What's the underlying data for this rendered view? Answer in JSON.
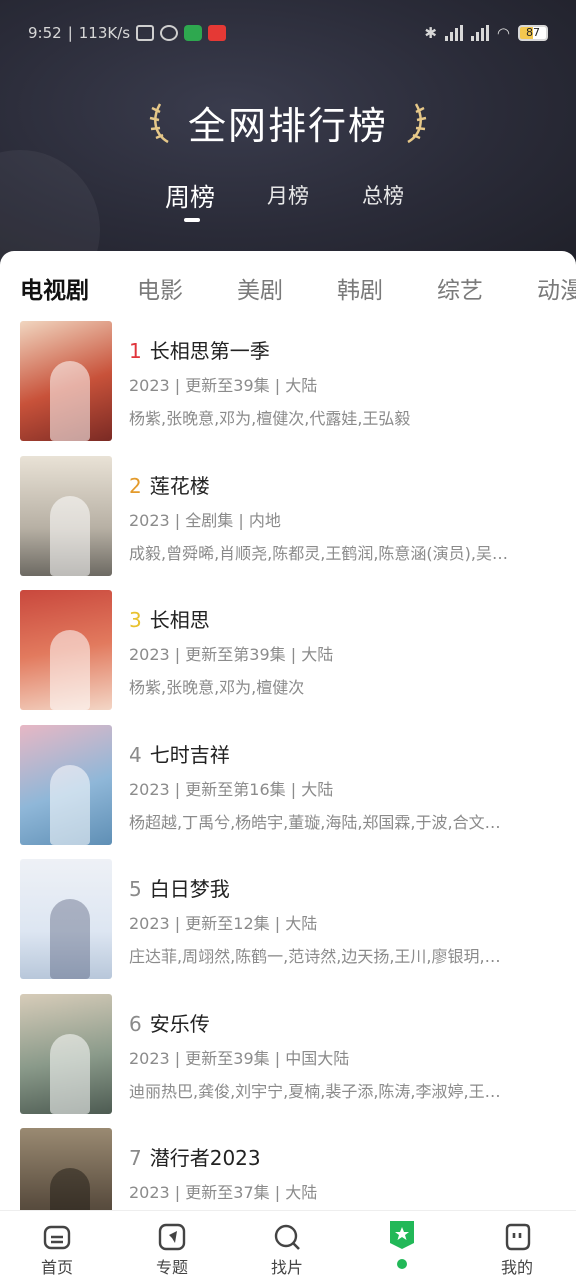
{
  "status_bar": {
    "time": "9:52",
    "speed": "113K/s",
    "battery": "87"
  },
  "header": {
    "title": "全网排行榜",
    "period_tabs": [
      "周榜",
      "月榜",
      "总榜"
    ],
    "active_period": "周榜"
  },
  "category_tabs": [
    "电视剧",
    "电影",
    "美剧",
    "韩剧",
    "综艺",
    "动漫"
  ],
  "active_category": "电视剧",
  "colors": {
    "rank_1": "#e0343b",
    "rank_2": "#e39a2b",
    "rank_3": "#e8c12e",
    "rank_other": "#8a8a8a",
    "accent_green": "#22b858"
  },
  "items": [
    {
      "rank": "1",
      "title": "长相思第一季",
      "meta": "2023 | 更新至39集 | 大陆",
      "cast": "杨紫,张晚意,邓为,檀健次,代露娃,王弘毅"
    },
    {
      "rank": "2",
      "title": "莲花楼",
      "meta": "2023 | 全剧集 | 内地",
      "cast": "成毅,曾舜晞,肖顺尧,陈都灵,王鹤润,陈意涵(演员),吴…"
    },
    {
      "rank": "3",
      "title": "长相思",
      "meta": "2023 | 更新至第39集 | 大陆",
      "cast": "杨紫,张晚意,邓为,檀健次"
    },
    {
      "rank": "4",
      "title": "七时吉祥",
      "meta": "2023 | 更新至第16集 | 大陆",
      "cast": "杨超越,丁禹兮,杨皓宇,董璇,海陆,郑国霖,于波,合文…"
    },
    {
      "rank": "5",
      "title": "白日梦我",
      "meta": "2023 | 更新至12集 | 大陆",
      "cast": "庄达菲,周翊然,陈鹤一,范诗然,边天扬,王川,廖银玥,…"
    },
    {
      "rank": "6",
      "title": "安乐传",
      "meta": "2023 | 更新至39集 | 中国大陆",
      "cast": "迪丽热巴,龚俊,刘宇宁,夏楠,裴子添,陈涛,李淑婷,王…"
    },
    {
      "rank": "7",
      "title": "潜行者2023",
      "meta": "2023 | 更新至37集 | 大陆",
      "cast": ""
    }
  ],
  "bottom_nav": [
    {
      "label": "首页",
      "icon": "home-icon"
    },
    {
      "label": "专题",
      "icon": "compass-icon"
    },
    {
      "label": "找片",
      "icon": "search-icon"
    },
    {
      "label": "",
      "icon": "star-badge-icon"
    },
    {
      "label": "我的",
      "icon": "profile-icon"
    }
  ]
}
